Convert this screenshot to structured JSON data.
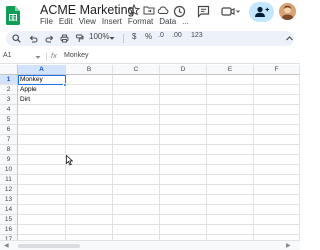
{
  "doc": {
    "title": "ACME Marketing"
  },
  "menu": [
    "File",
    "Edit",
    "View",
    "Insert",
    "Format",
    "Data",
    "..."
  ],
  "toolbar": {
    "zoom": "100%",
    "currency_symbol": "$",
    "percent_symbol": "%",
    "decrease_decimal": ".0",
    "increase_decimal": ".00",
    "number_format": "123"
  },
  "formula_bar": {
    "cell_ref": "A1",
    "fx_label": "fx",
    "value": "Monkey"
  },
  "grid": {
    "columns": [
      "A",
      "B",
      "C",
      "D",
      "E",
      "F"
    ],
    "rows": [
      "1",
      "2",
      "3",
      "4",
      "5",
      "6",
      "7",
      "8",
      "9",
      "10",
      "11",
      "12",
      "13",
      "14",
      "15",
      "16",
      "17"
    ],
    "cells": {
      "A1": "Monkey",
      "A2": "Apple",
      "A3": "Dirt"
    },
    "selected": "A1"
  },
  "colors": {
    "accent": "#1a73e8",
    "share_bg": "#c2e7ff",
    "toolbar_bg": "#edf2fa",
    "sheets_green": "#0f9d58"
  },
  "icons": {
    "app": "google-sheets-icon",
    "star": "star-icon",
    "folder": "move-folder-icon",
    "cloud": "cloud-saved-icon",
    "history": "history-icon",
    "comment": "comment-icon",
    "meet": "video-call-icon",
    "share": "share-person-icon"
  }
}
